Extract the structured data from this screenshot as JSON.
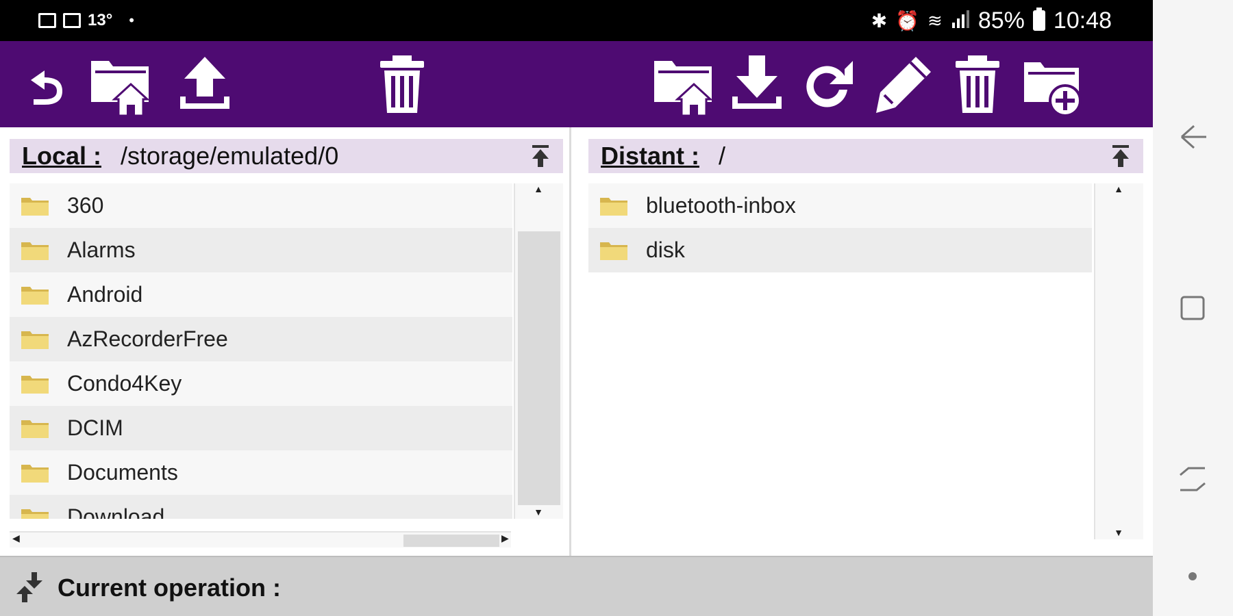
{
  "status_bar": {
    "temperature": "13°",
    "dot": "•",
    "battery_percent": "85%",
    "time": "10:48"
  },
  "toolbar": {
    "left_buttons": [
      "back-icon",
      "home-folder-icon",
      "upload-icon",
      "delete-icon"
    ],
    "right_buttons": [
      "home-folder-icon",
      "download-icon",
      "refresh-icon",
      "edit-icon",
      "delete-icon",
      "new-folder-icon"
    ],
    "bg_color": "#4e0b72"
  },
  "local": {
    "label": "Local :",
    "path": "/storage/emulated/0",
    "items": [
      "360",
      "Alarms",
      "Android",
      "AzRecorderFree",
      "Condo4Key",
      "DCIM",
      "Documents",
      "Download"
    ]
  },
  "remote": {
    "label": "Distant :",
    "path": "/",
    "items": [
      "bluetooth-inbox",
      "disk"
    ]
  },
  "operation": {
    "label": "Current operation :"
  }
}
